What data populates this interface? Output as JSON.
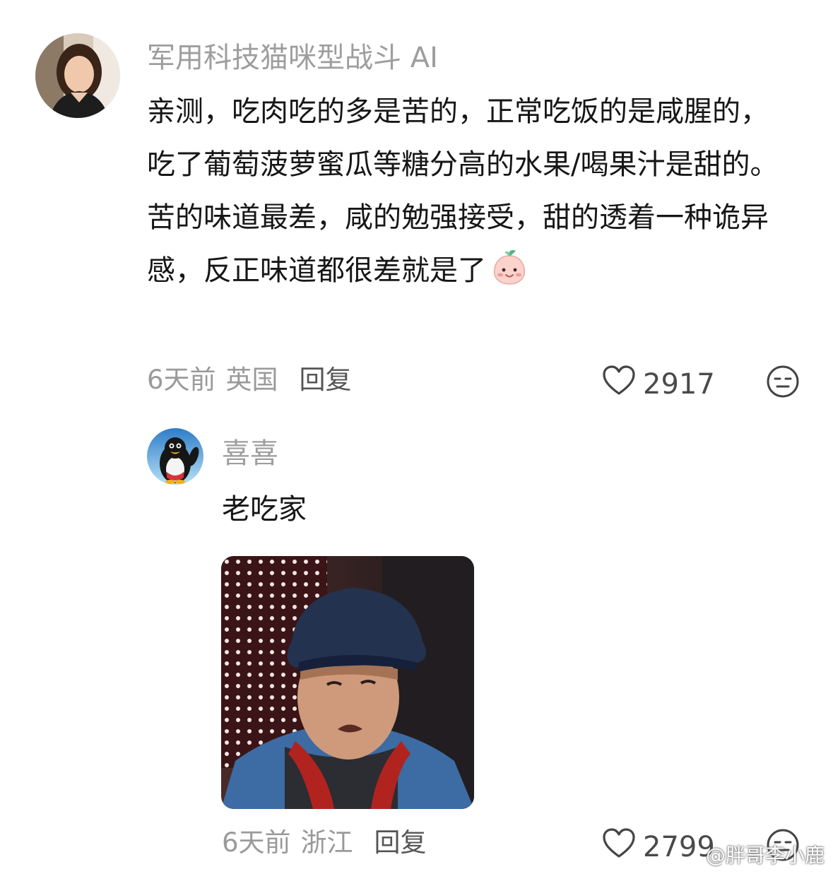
{
  "comment": {
    "username": "军用科技猫咪型战斗 AI",
    "text": "亲测，吃肉吃的多是苦的，正常吃饭的是咸腥的，吃了葡萄菠萝蜜瓜等糖分高的水果/喝果汁是甜的。苦的味道最差，咸的勉强接受，甜的透着一种诡异感，反正味道都很差就是了",
    "emoji_icon": "peach-smile-emoji",
    "time": "6天前",
    "location": "英国",
    "reply_label": "回复",
    "likes": "2917"
  },
  "reply": {
    "username": "喜喜",
    "text": "老吃家",
    "image_icon": "meme-photo-man-in-cap",
    "time": "6天前",
    "location": "浙江",
    "reply_label": "回复",
    "likes": "2799"
  },
  "watermark": "@胖哥李小鹿",
  "colors": {
    "username": "#9e9e9e",
    "text": "#161616",
    "meta": "#9a9a9a",
    "accent_reply": "#555555"
  }
}
